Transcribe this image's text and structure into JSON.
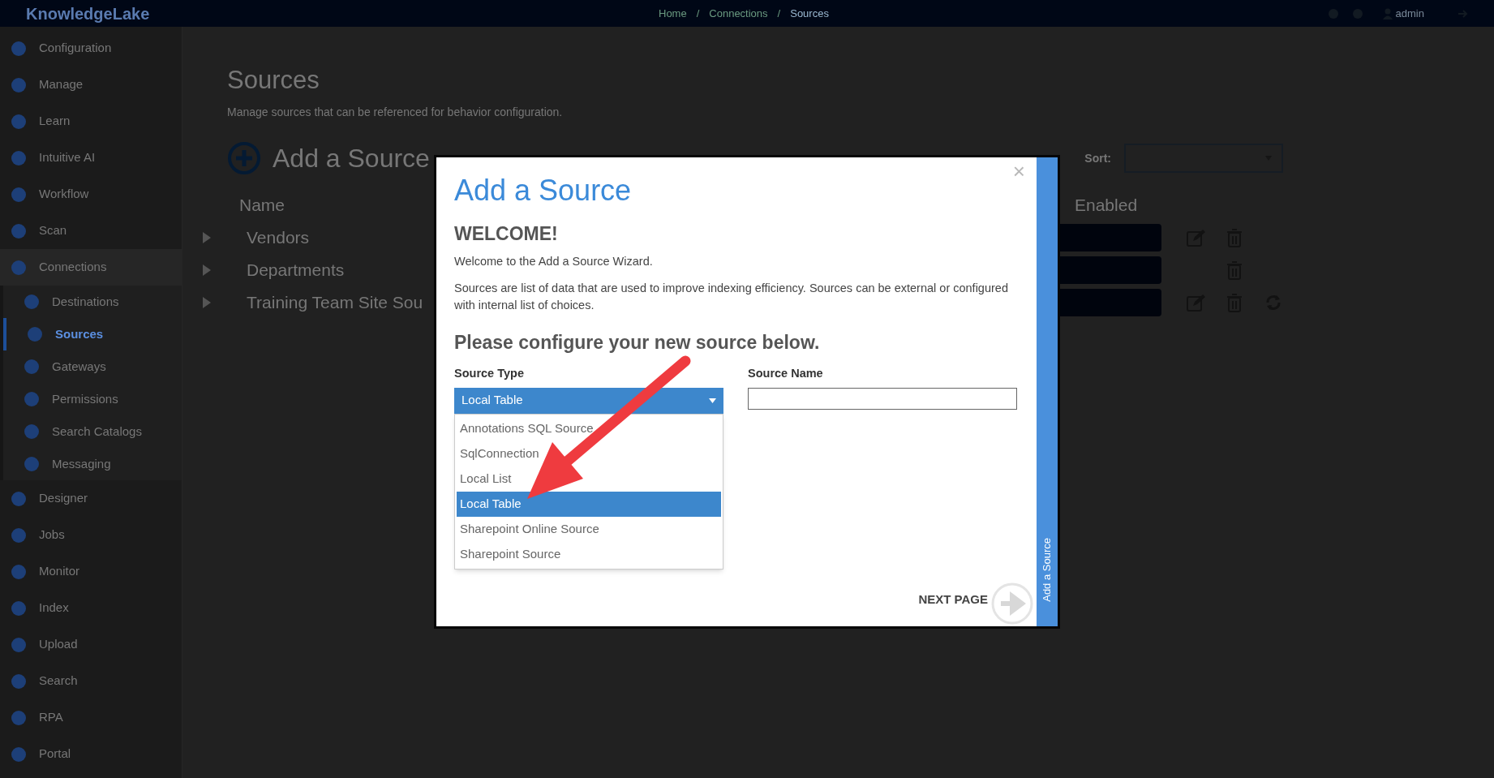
{
  "topbar": {
    "brand": "KnowledgeLake",
    "breadcrumbs": [
      "Home",
      "Connections",
      "Sources"
    ],
    "separator": "/",
    "user": "admin"
  },
  "sidebar": {
    "items": [
      {
        "label": "Configuration",
        "selected": false
      },
      {
        "label": "Manage",
        "selected": false
      },
      {
        "label": "Learn",
        "selected": false
      },
      {
        "label": "Intuitive AI",
        "selected": false
      },
      {
        "label": "Workflow",
        "selected": false
      },
      {
        "label": "Scan",
        "selected": false
      },
      {
        "label": "Connections",
        "selected": false,
        "children": [
          {
            "label": "Destinations",
            "selected": false
          },
          {
            "label": "Sources",
            "selected": true
          },
          {
            "label": "Gateways",
            "selected": false
          },
          {
            "label": "Permissions",
            "selected": false
          },
          {
            "label": "Search Catalogs",
            "selected": false
          },
          {
            "label": "Messaging",
            "selected": false
          }
        ]
      },
      {
        "label": "Designer",
        "selected": false
      },
      {
        "label": "Jobs",
        "selected": false
      },
      {
        "label": "Monitor",
        "selected": false
      },
      {
        "label": "Index",
        "selected": false
      },
      {
        "label": "Upload",
        "selected": false
      },
      {
        "label": "Search",
        "selected": false
      },
      {
        "label": "RPA",
        "selected": false
      },
      {
        "label": "Portal",
        "selected": false
      }
    ]
  },
  "page": {
    "title": "Sources",
    "subtitle": "Manage sources that can be referenced for behavior configuration.",
    "add_label": "Add a Source",
    "sort_label": "Sort:",
    "table": {
      "columns": [
        "Name",
        "Enabled"
      ],
      "rows": [
        {
          "name": "Vendors",
          "edit": true,
          "delete": true,
          "refresh": false
        },
        {
          "name": "Departments",
          "edit": false,
          "delete": true,
          "refresh": false
        },
        {
          "name": "Training Team Site Sou",
          "edit": true,
          "delete": true,
          "refresh": true
        }
      ]
    }
  },
  "modal": {
    "title": "Add a Source",
    "close": "×",
    "heading": "WELCOME!",
    "intro": "Welcome to the Add a Source Wizard.",
    "description": "Sources are list of data that are used to improve indexing efficiency. Sources can be external or configured with internal list of choices.",
    "configure": "Please configure your new source below.",
    "source_type": {
      "label": "Source Type",
      "value": "Local Table",
      "expanded": true,
      "options": [
        {
          "label": "Annotations SQL Source",
          "selected": false
        },
        {
          "label": "SqlConnection",
          "selected": false
        },
        {
          "label": "Local List",
          "selected": false
        },
        {
          "label": "Local Table",
          "selected": true
        },
        {
          "label": "Sharepoint Online Source",
          "selected": false
        },
        {
          "label": "Sharepoint Source",
          "selected": false
        }
      ]
    },
    "source_name": {
      "label": "Source Name"
    },
    "next": "NEXT PAGE",
    "side_tab": "Add a Source"
  }
}
